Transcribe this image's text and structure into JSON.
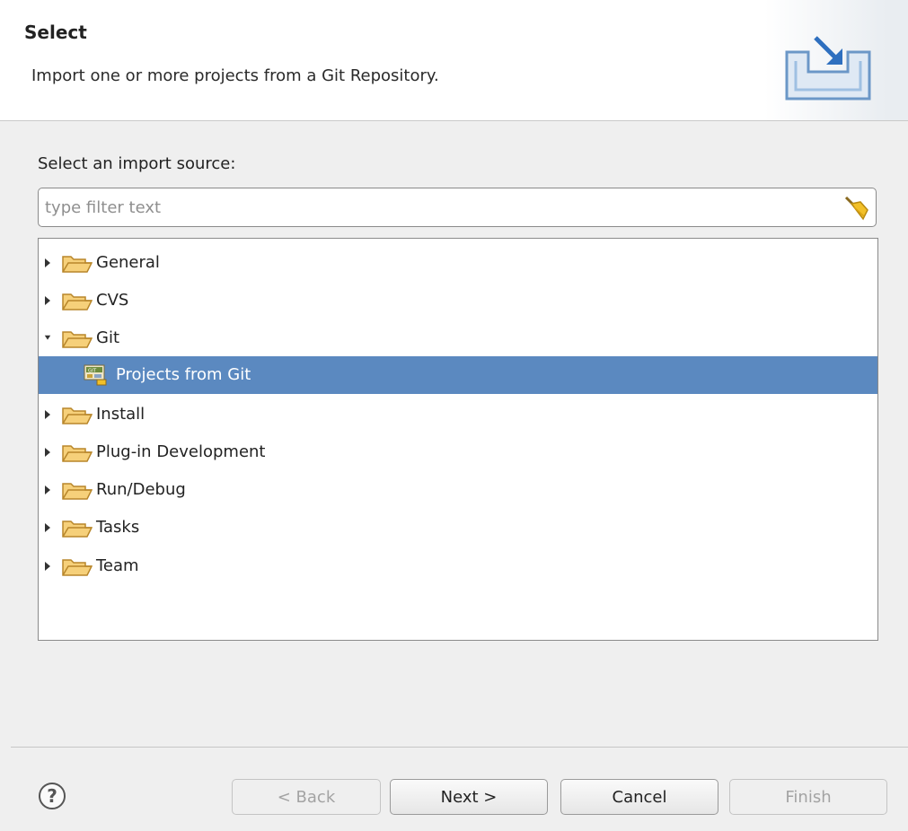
{
  "header": {
    "title": "Select",
    "description": "Import one or more projects from a Git Repository."
  },
  "content": {
    "source_label": "Select an import source:",
    "filter_placeholder": "type filter text",
    "filter_value": ""
  },
  "tree": {
    "items": [
      {
        "label": "General",
        "expanded": false
      },
      {
        "label": "CVS",
        "expanded": false
      },
      {
        "label": "Git",
        "expanded": true
      },
      {
        "label": "Projects from Git",
        "selected": true,
        "icon": "git-icon"
      },
      {
        "label": "Install",
        "expanded": false
      },
      {
        "label": "Plug-in Development",
        "expanded": false
      },
      {
        "label": "Run/Debug",
        "expanded": false
      },
      {
        "label": "Tasks",
        "expanded": false
      },
      {
        "label": "Team",
        "expanded": false
      }
    ]
  },
  "footer": {
    "help_label": "?",
    "back_label": "< Back",
    "next_label": "Next >",
    "cancel_label": "Cancel",
    "finish_label": "Finish"
  },
  "colors": {
    "selection": "#5b89c0",
    "folder": "#e9b44c",
    "accent": "#3a78c8"
  }
}
